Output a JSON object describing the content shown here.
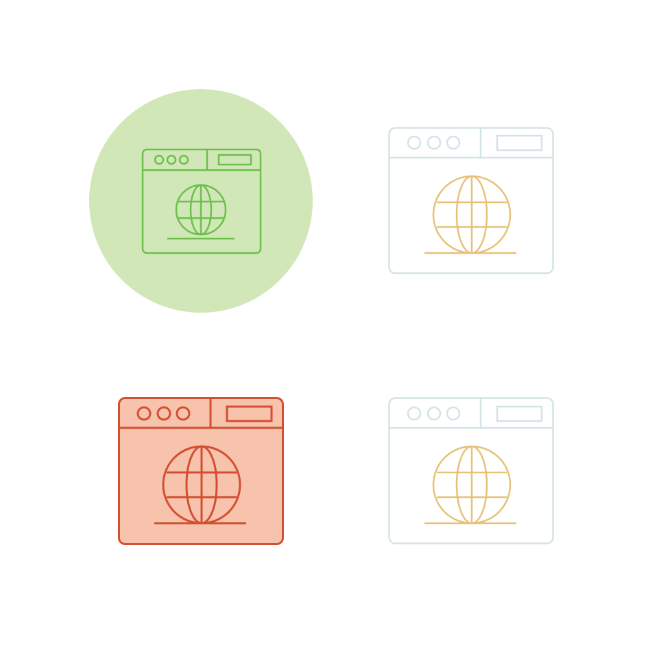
{
  "icons": [
    {
      "name": "browser-globe-icon-circle-style",
      "style": "circle-background",
      "colors": {
        "background": "#d2e7b8",
        "window_stroke": "#6cc04a",
        "globe_stroke": "#6cc04a"
      }
    },
    {
      "name": "browser-globe-icon-outline-style",
      "style": "outline",
      "colors": {
        "window_stroke": "#d4e3e6",
        "globe_stroke": "#e7c176"
      }
    },
    {
      "name": "browser-globe-icon-filled-style",
      "style": "filled",
      "colors": {
        "window_fill": "#f7c3ad",
        "window_stroke": "#d24f2f",
        "globe_stroke": "#d24f2f"
      }
    },
    {
      "name": "browser-globe-icon-outline-style-2",
      "style": "outline",
      "colors": {
        "window_stroke": "#d4e3e6",
        "globe_stroke": "#e7c176"
      }
    }
  ]
}
